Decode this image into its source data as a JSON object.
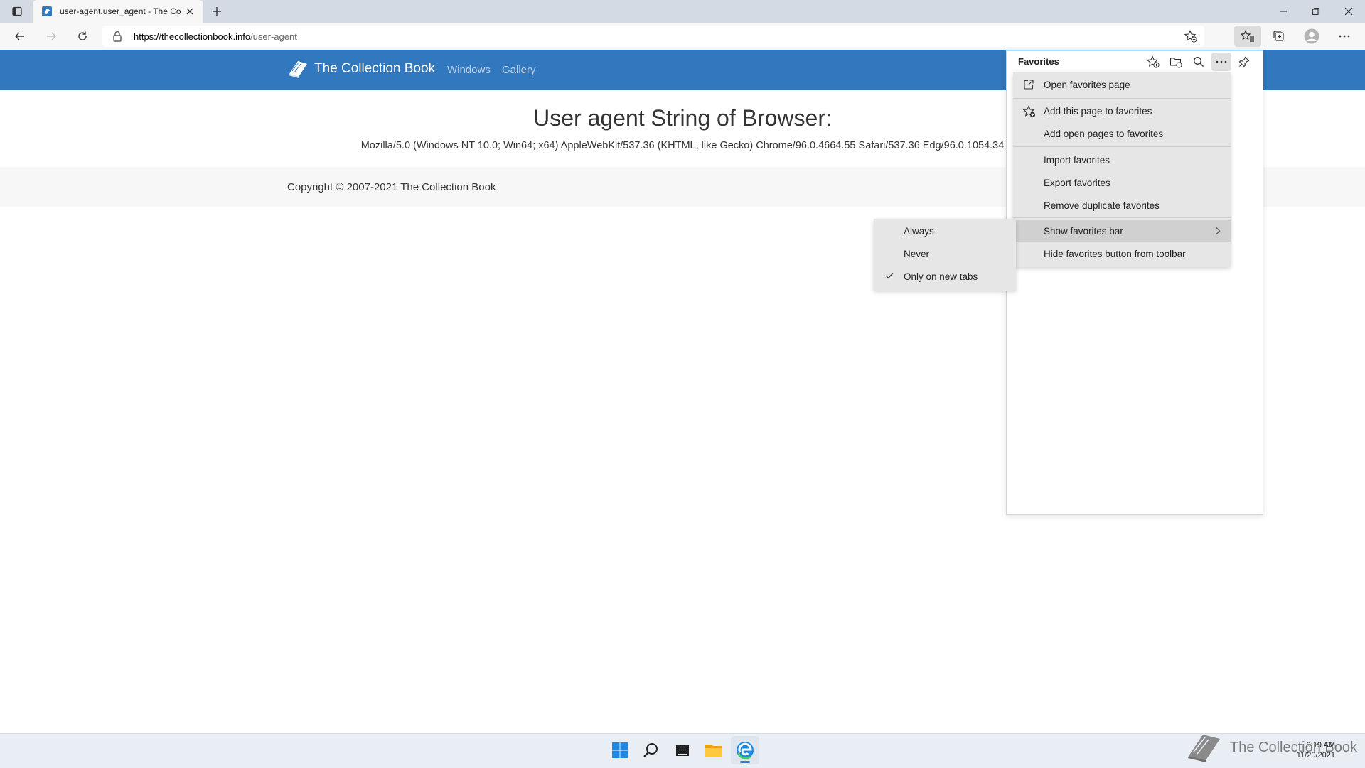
{
  "browser": {
    "tab": {
      "title": "user-agent.user_agent - The Collection Book"
    },
    "address": {
      "url_host": "https://thecollectionbook.info",
      "url_path": "/user-agent"
    }
  },
  "site": {
    "brand": "The Collection Book",
    "nav": [
      "Windows",
      "Gallery"
    ],
    "heading": "User agent String of Browser:",
    "ua_string": "Mozilla/5.0 (Windows NT 10.0; Win64; x64) AppleWebKit/537.36 (KHTML, like Gecko) Chrome/96.0.4664.55 Safari/537.36 Edg/96.0.1054.34",
    "copyright": "Copyright © 2007-2021 The Collection Book"
  },
  "favorites_panel": {
    "title": "Favorites",
    "menu": {
      "open_page": "Open favorites page",
      "add_this": "Add this page to favorites",
      "add_open": "Add open pages to favorites",
      "import": "Import favorites",
      "export": "Export favorites",
      "remove_dup": "Remove duplicate favorites",
      "show_bar": "Show favorites bar",
      "hide_button": "Hide favorites button from toolbar"
    },
    "submenu": {
      "always": "Always",
      "never": "Never",
      "new_tabs": "Only on new tabs",
      "selected": "Only on new tabs"
    }
  },
  "taskbar": {
    "watermark": "The Collection Book",
    "time": "9:19 AM",
    "date": "11/20/2021"
  },
  "colors": {
    "site_header": "#3278be",
    "taskbar": "#e9eef5",
    "menu_bg": "#e6e6e6"
  }
}
